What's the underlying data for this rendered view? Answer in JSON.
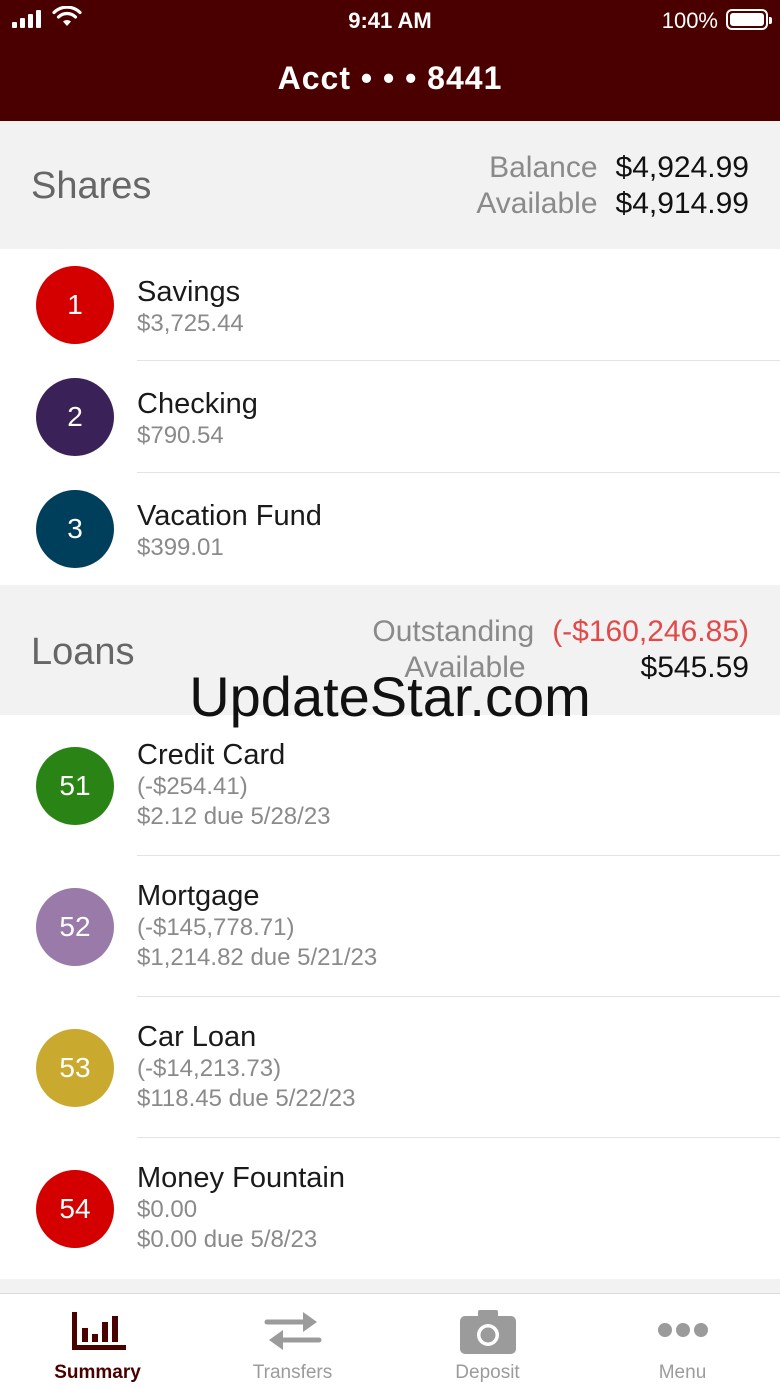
{
  "status_bar": {
    "time": "9:41 AM",
    "battery": "100%"
  },
  "header": {
    "title": "Acct • • • 8441"
  },
  "shares": {
    "title": "Shares",
    "balance_label": "Balance",
    "balance_value": "$4,924.99",
    "available_label": "Available",
    "available_value": "$4,914.99",
    "items": [
      {
        "badge": "1",
        "name": "Savings",
        "amount": "$3,725.44",
        "color": "#d40000"
      },
      {
        "badge": "2",
        "name": "Checking",
        "amount": "$790.54",
        "color": "#3a2158"
      },
      {
        "badge": "3",
        "name": "Vacation Fund",
        "amount": "$399.01",
        "color": "#003f5c"
      }
    ]
  },
  "loans": {
    "title": "Loans",
    "outstanding_label": "Outstanding",
    "outstanding_value": "(-$160,246.85)",
    "available_label": "Available",
    "available_value": "$545.59",
    "items": [
      {
        "badge": "51",
        "name": "Credit Card",
        "balance": "(-$254.41)",
        "due": "$2.12 due 5/28/23",
        "color": "#2a8415"
      },
      {
        "badge": "52",
        "name": "Mortgage",
        "balance": "(-$145,778.71)",
        "due": "$1,214.82 due 5/21/23",
        "color": "#9a7aa8"
      },
      {
        "badge": "53",
        "name": "Car Loan",
        "balance": "(-$14,213.73)",
        "due": "$118.45 due 5/22/23",
        "color": "#c9aa2e"
      },
      {
        "badge": "54",
        "name": "Money Fountain",
        "balance": "$0.00",
        "due": "$0.00 due 5/8/23",
        "color": "#d40000"
      }
    ]
  },
  "watermark": "UpdateStar.com",
  "tabs": [
    {
      "label": "Summary",
      "icon": "bar-chart-icon",
      "active": true
    },
    {
      "label": "Transfers",
      "icon": "swap-arrows-icon",
      "active": false
    },
    {
      "label": "Deposit",
      "icon": "camera-icon",
      "active": false
    },
    {
      "label": "Menu",
      "icon": "more-dots-icon",
      "active": false
    }
  ],
  "colors": {
    "header_bg": "#4b0000",
    "accent": "#4b0000",
    "negative": "#e24a4a",
    "section_bg": "#f2f2f2"
  }
}
